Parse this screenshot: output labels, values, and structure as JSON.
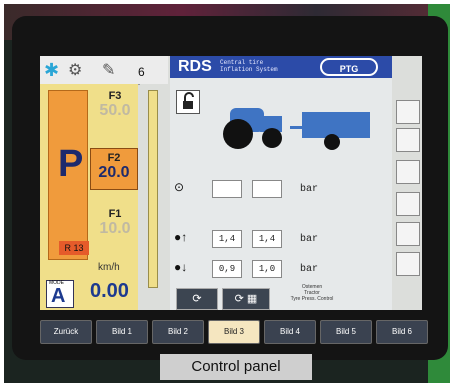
{
  "caption": "Control panel",
  "header_icons": [
    "snowflake-icon",
    "hitch-icon",
    "wrench-icon"
  ],
  "header_count": "6",
  "gears": {
    "park": "P",
    "range": "R 13",
    "f3": {
      "label": "F3",
      "value": "50.0"
    },
    "f2": {
      "label": "F2",
      "value": "20.0"
    },
    "f1": {
      "label": "F1",
      "value": "10.0"
    }
  },
  "speed": {
    "unit": "km/h",
    "value": "0.00",
    "mode_label": "MODE",
    "mode": "A"
  },
  "rds": {
    "title": "RDS",
    "subtitle_line1": "Central tire",
    "subtitle_line2": "Inflation System",
    "brand": "PTG"
  },
  "pressure_rows": [
    {
      "left": "",
      "right": "",
      "unit": "bar"
    },
    {
      "left": "1,4",
      "right": "1,4",
      "unit": "bar"
    },
    {
      "left": "0,9",
      "right": "1,0",
      "unit": "bar"
    }
  ],
  "footnote": [
    "Ostemen",
    "Tractor",
    "Tyre Press. Control"
  ],
  "tabs": [
    "Zurück",
    "Bild 1",
    "Bild 2",
    "Bild 3",
    "Bild 4",
    "Bild 5",
    "Bild 6"
  ],
  "active_tab": "Bild 3",
  "colors": {
    "accent": "#2c4ba8",
    "gear_orange": "#f09b3c",
    "panel_yellow": "#f0df8a",
    "tractor_blue": "#3f74c3"
  }
}
